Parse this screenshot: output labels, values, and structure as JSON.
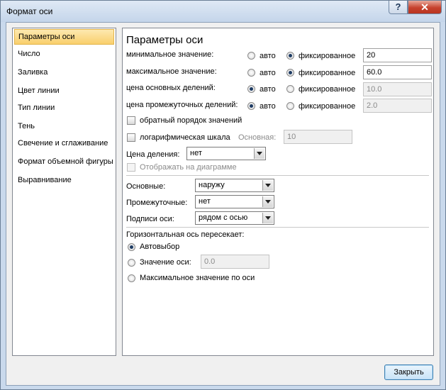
{
  "window": {
    "title": "Формат оси"
  },
  "titlebar": {
    "help": "?",
    "close": "✕"
  },
  "nav": {
    "items": [
      "Параметры оси",
      "Число",
      "Заливка",
      "Цвет линии",
      "Тип линии",
      "Тень",
      "Свечение и сглаживание",
      "Формат объемной фигуры",
      "Выравнивание"
    ],
    "selected": "Параметры оси"
  },
  "panel": {
    "heading": "Параметры оси",
    "auto_label": "авто",
    "fixed_label": "фиксированное",
    "rows": [
      {
        "label": "минимальное значение:",
        "mode": "fixed",
        "value": "20"
      },
      {
        "label": "максимальное значение:",
        "mode": "fixed",
        "value": "60.0"
      },
      {
        "label": "цена основных делений:",
        "mode": "auto",
        "value": "10.0"
      },
      {
        "label": "цена промежуточных делений:",
        "mode": "auto",
        "value": "2.0"
      }
    ],
    "reverse_order": "обратный порядок значений",
    "log_scale": "логарифмическая шкала",
    "log_base_label": "Основная:",
    "log_base_value": "10",
    "tick_price_label": "Цена деления:",
    "tick_price_value": "нет",
    "show_on_chart": "Отображать на диаграмме",
    "major_label": "Основные:",
    "major_value": "наружу",
    "minor_label": "Промежуточные:",
    "minor_value": "нет",
    "axis_labels_label": "Подписи оси:",
    "axis_labels_value": "рядом с осью",
    "cross_heading": "Горизонтальная ось пересекает:",
    "cross_auto": "Автовыбор",
    "cross_value_label": "Значение оси:",
    "cross_value": "0.0",
    "cross_max": "Максимальное значение по оси"
  },
  "footer": {
    "close_label": "Закрыть"
  }
}
